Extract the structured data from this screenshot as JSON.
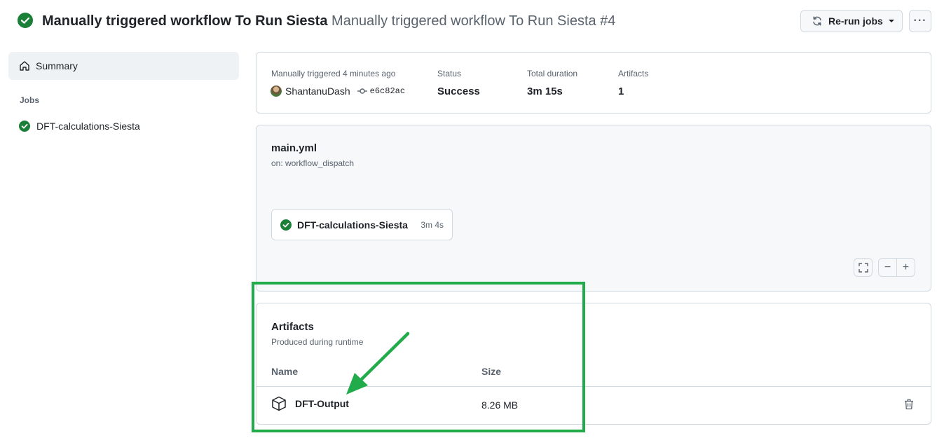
{
  "header": {
    "title_main": "Manually triggered workflow To Run Siesta",
    "title_sub": "Manually triggered workflow To Run Siesta #4",
    "rerun_label": "Re-run jobs",
    "more_label": "···"
  },
  "sidebar": {
    "summary_label": "Summary",
    "jobs_heading": "Jobs",
    "jobs": [
      {
        "label": "DFT-calculations-Siesta",
        "status": "success"
      }
    ]
  },
  "run_summary": {
    "trigger_label": "Manually triggered 4 minutes ago",
    "actor": "ShantanuDash",
    "commit": "e6c82ac",
    "status_label": "Status",
    "status_value": "Success",
    "duration_label": "Total duration",
    "duration_value": "3m 15s",
    "artifacts_label": "Artifacts",
    "artifacts_value": "1"
  },
  "workflow_graph": {
    "file_name": "main.yml",
    "trigger": "on: workflow_dispatch",
    "job": {
      "label": "DFT-calculations-Siesta",
      "duration": "3m 4s",
      "status": "success"
    },
    "zoom_out_label": "−",
    "zoom_in_label": "+"
  },
  "artifacts": {
    "title": "Artifacts",
    "subtitle": "Produced during runtime",
    "col_name": "Name",
    "col_size": "Size",
    "rows": [
      {
        "name": "DFT-Output",
        "size": "8.26 MB"
      }
    ]
  },
  "colors": {
    "success": "#1a7f37",
    "annotation_green": "#22ab4a",
    "border": "#d1d9e0",
    "muted_text": "#59636e"
  },
  "icons": [
    "check-circle-icon",
    "sync-icon",
    "caret-down-icon",
    "kebab-icon",
    "home-icon",
    "commit-icon",
    "fullscreen-icon",
    "package-icon",
    "trash-icon",
    "arrow-annotation"
  ]
}
